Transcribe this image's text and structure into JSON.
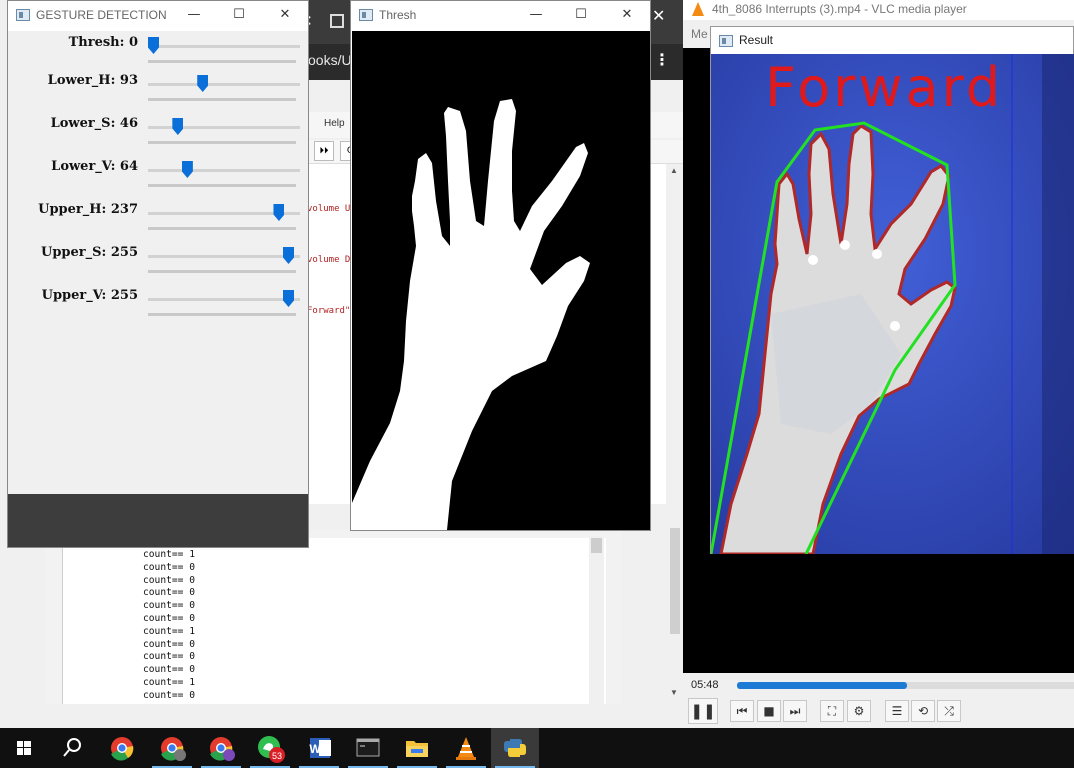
{
  "background": {
    "browser_url_text": "ooks/U",
    "menu_help": "Help",
    "toolbar_buttons": [
      "⏵⏵",
      "C"
    ],
    "code_lines": [
      "volume U",
      "volume D",
      "Forward\""
    ],
    "output_lines": [
      "count== 1",
      "count== 0",
      "count== 0",
      "count== 0",
      "count== 0",
      "count== 0",
      "count== 1",
      "count== 0",
      "count== 0",
      "count== 0",
      "count== 1",
      "count== 0"
    ]
  },
  "gesture_window": {
    "title": "GESTURE DETECTION",
    "sliders": [
      {
        "label": "Thresh: 0",
        "value": 0,
        "max": 255
      },
      {
        "label": "Lower_H: 93",
        "value": 93,
        "max": 255
      },
      {
        "label": "Lower_S: 46",
        "value": 46,
        "max": 255
      },
      {
        "label": "Lower_V: 64",
        "value": 64,
        "max": 255
      },
      {
        "label": "Upper_H: 237",
        "value": 237,
        "max": 255
      },
      {
        "label": "Upper_S: 255",
        "value": 255,
        "max": 255
      },
      {
        "label": "Upper_V: 255",
        "value": 255,
        "max": 255
      }
    ]
  },
  "thresh_window": {
    "title": "Thresh"
  },
  "vlc": {
    "title": "4th_8086 Interrupts (3).mp4 - VLC media player",
    "menu_media": "Me",
    "time": "05:48",
    "progress": 0.5
  },
  "result_window": {
    "title": "Result",
    "gesture_text": "Forward",
    "colors": {
      "text": "#e01a1a",
      "hull": "#22e022",
      "contour": "#b02828",
      "background": "#2c47b9"
    }
  },
  "caption_buttons": {
    "minimize": "—",
    "maximize": "☐",
    "close": "✕"
  },
  "taskbar": {
    "badge_count": "53",
    "items": [
      "start-icon",
      "search-icon",
      "chrome-icon",
      "chrome-profile-icon",
      "chrome-j-icon",
      "whatsapp-icon",
      "word-icon",
      "terminal-icon",
      "explorer-icon",
      "vlc-icon",
      "python-icon"
    ]
  }
}
